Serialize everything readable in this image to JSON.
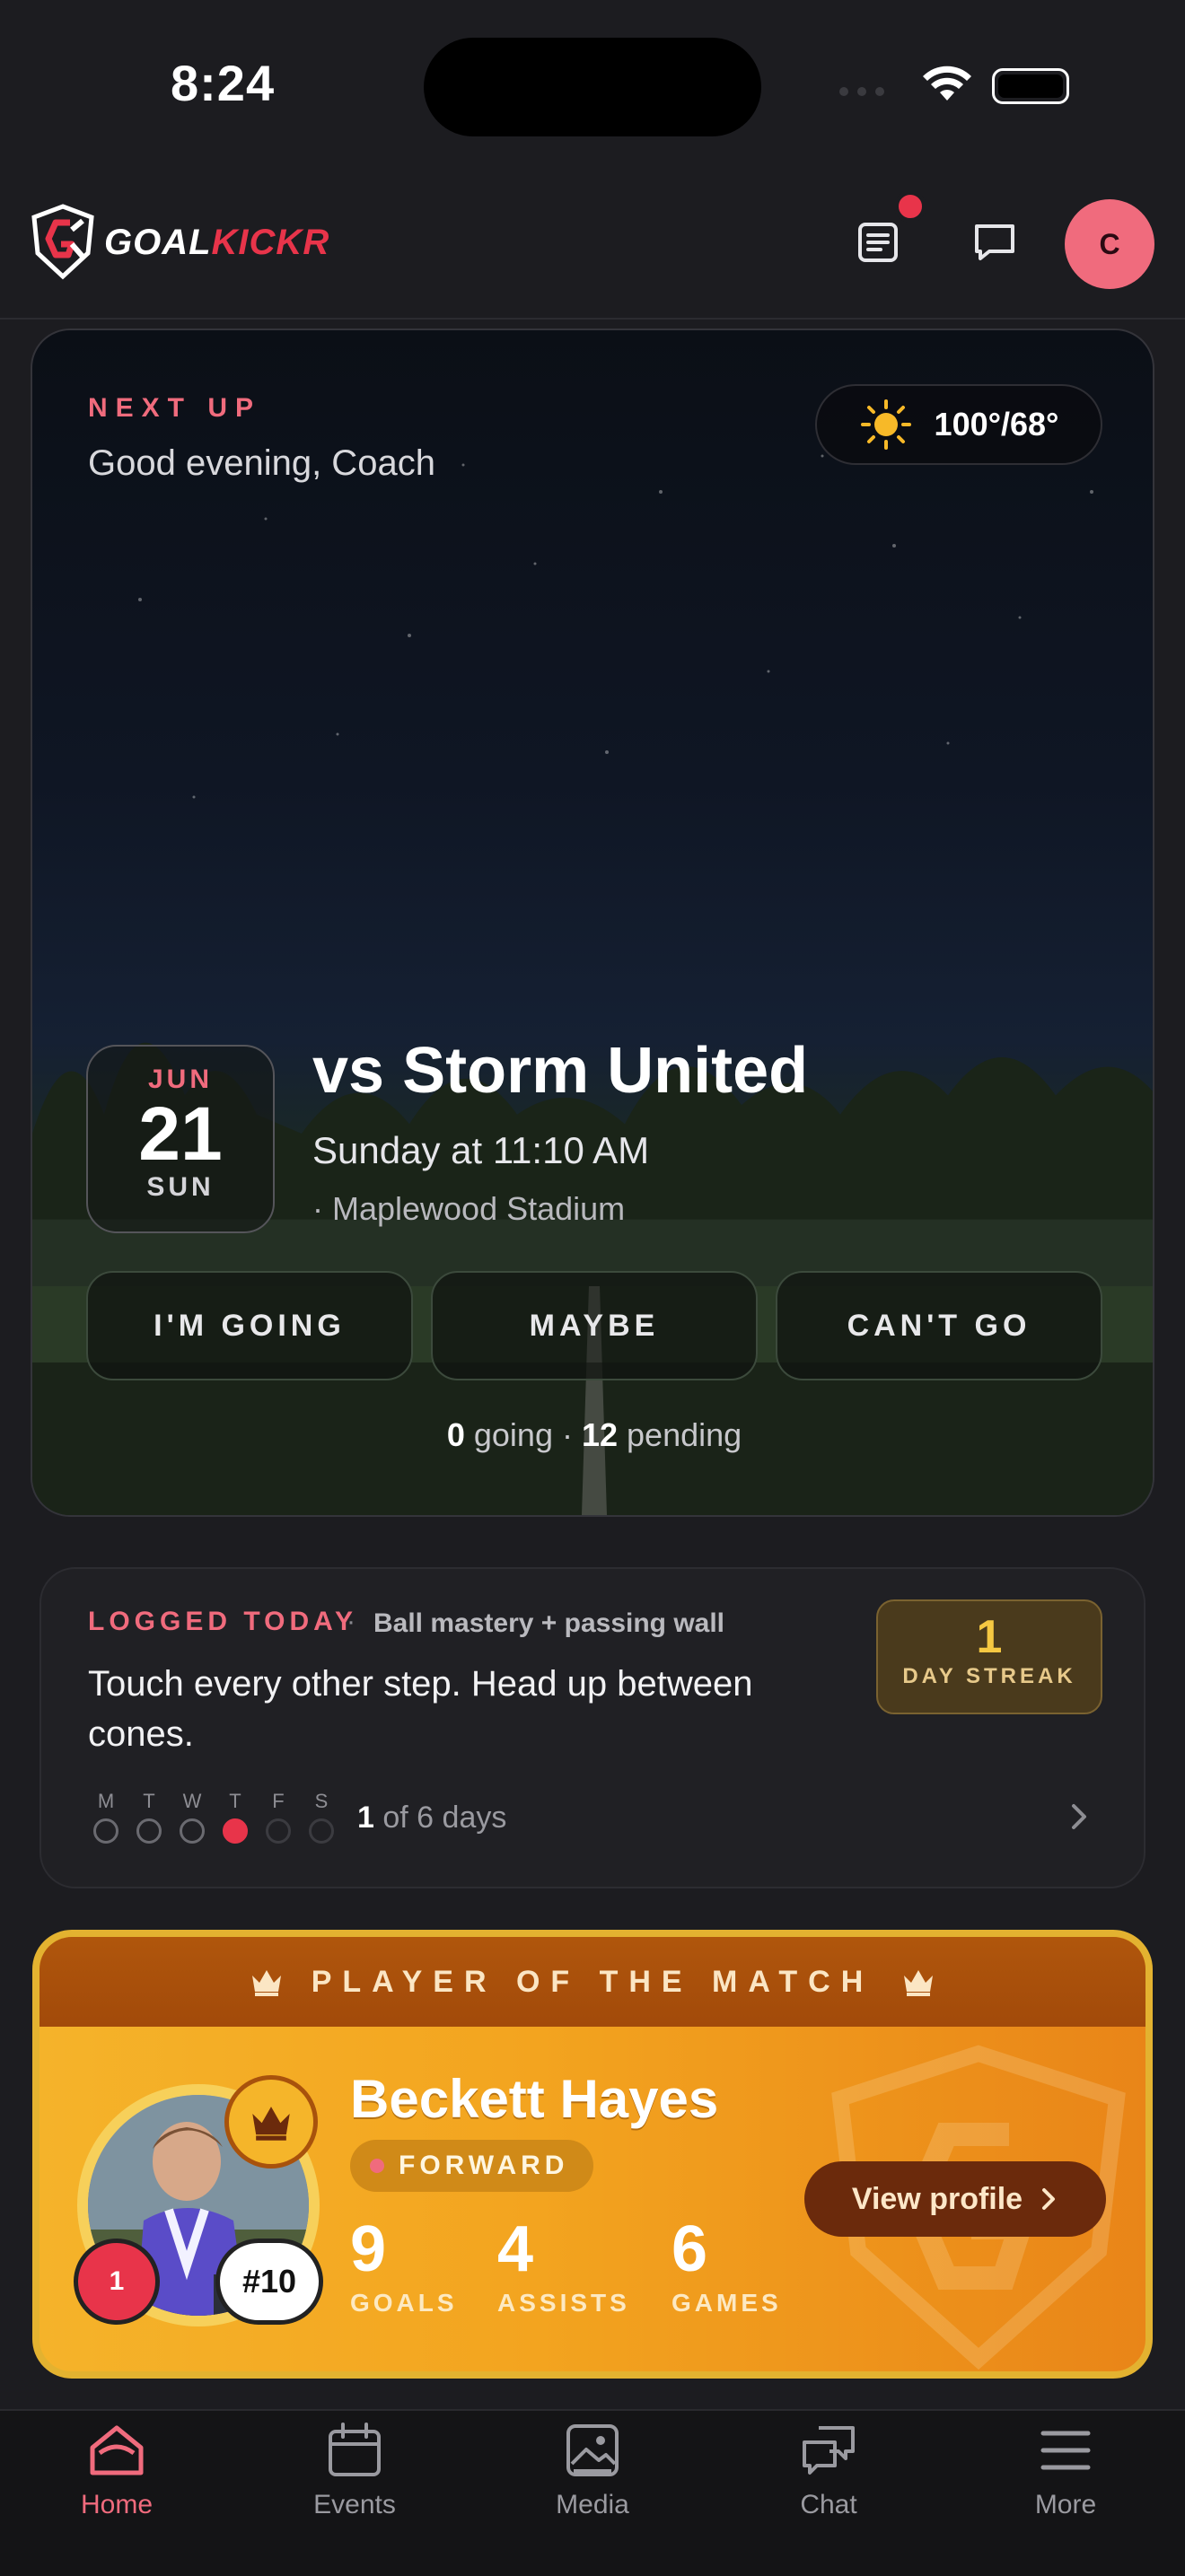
{
  "status_bar": {
    "time": "8:24"
  },
  "header": {
    "logo_text_a": "GOAL",
    "logo_text_b": "KICKR",
    "avatar_initial": "C",
    "has_notification": true
  },
  "next_up": {
    "tag": "NEXT UP",
    "greeting": "Good evening, Coach",
    "weather": {
      "icon": "sun-icon",
      "temp": "100°/68°"
    },
    "date": {
      "month": "JUN",
      "day": "21",
      "weekday": "SUN"
    },
    "opponent": "vs Storm United",
    "when": "Sunday at 11:10 AM",
    "venue": "· Maplewood Stadium",
    "rsvp": {
      "going": "I'M GOING",
      "maybe": "MAYBE",
      "cant": "CAN'T GO"
    },
    "counts": {
      "going_num": "0",
      "going_label": "going",
      "sep": " · ",
      "pending_num": "12",
      "pending_label": "pending"
    }
  },
  "logged": {
    "tag": "LOGGED TODAY",
    "sep": "·",
    "drill": "Ball mastery + passing wall",
    "note": "Touch every other step. Head up between cones.",
    "streak": {
      "value": "1",
      "label": "DAY STREAK"
    },
    "week": [
      {
        "label": "M",
        "state": "empty"
      },
      {
        "label": "T",
        "state": "empty"
      },
      {
        "label": "W",
        "state": "empty"
      },
      {
        "label": "T",
        "state": "filled"
      },
      {
        "label": "F",
        "state": "dim"
      },
      {
        "label": "S",
        "state": "dim"
      }
    ],
    "progress": {
      "count": "1",
      "suffix": "of 6 days"
    }
  },
  "potm": {
    "title": "PLAYER OF THE MATCH",
    "player_name": "Beckett Hayes",
    "position": "FORWARD",
    "rank": "1",
    "jersey": "#10",
    "stats": [
      {
        "value": "9",
        "label": "GOALS"
      },
      {
        "value": "4",
        "label": "ASSISTS"
      },
      {
        "value": "6",
        "label": "GAMES"
      }
    ],
    "view_profile": "View profile"
  },
  "tabs": [
    {
      "label": "Home",
      "icon": "home-icon",
      "active": true
    },
    {
      "label": "Events",
      "icon": "calendar-icon",
      "active": false
    },
    {
      "label": "Media",
      "icon": "photos-icon",
      "active": false
    },
    {
      "label": "Chat",
      "icon": "chat-icon",
      "active": false
    },
    {
      "label": "More",
      "icon": "menu-icon",
      "active": false
    }
  ],
  "colors": {
    "accent": "#e8344a",
    "gold": "#f5b32a",
    "background": "#1c1c20"
  }
}
